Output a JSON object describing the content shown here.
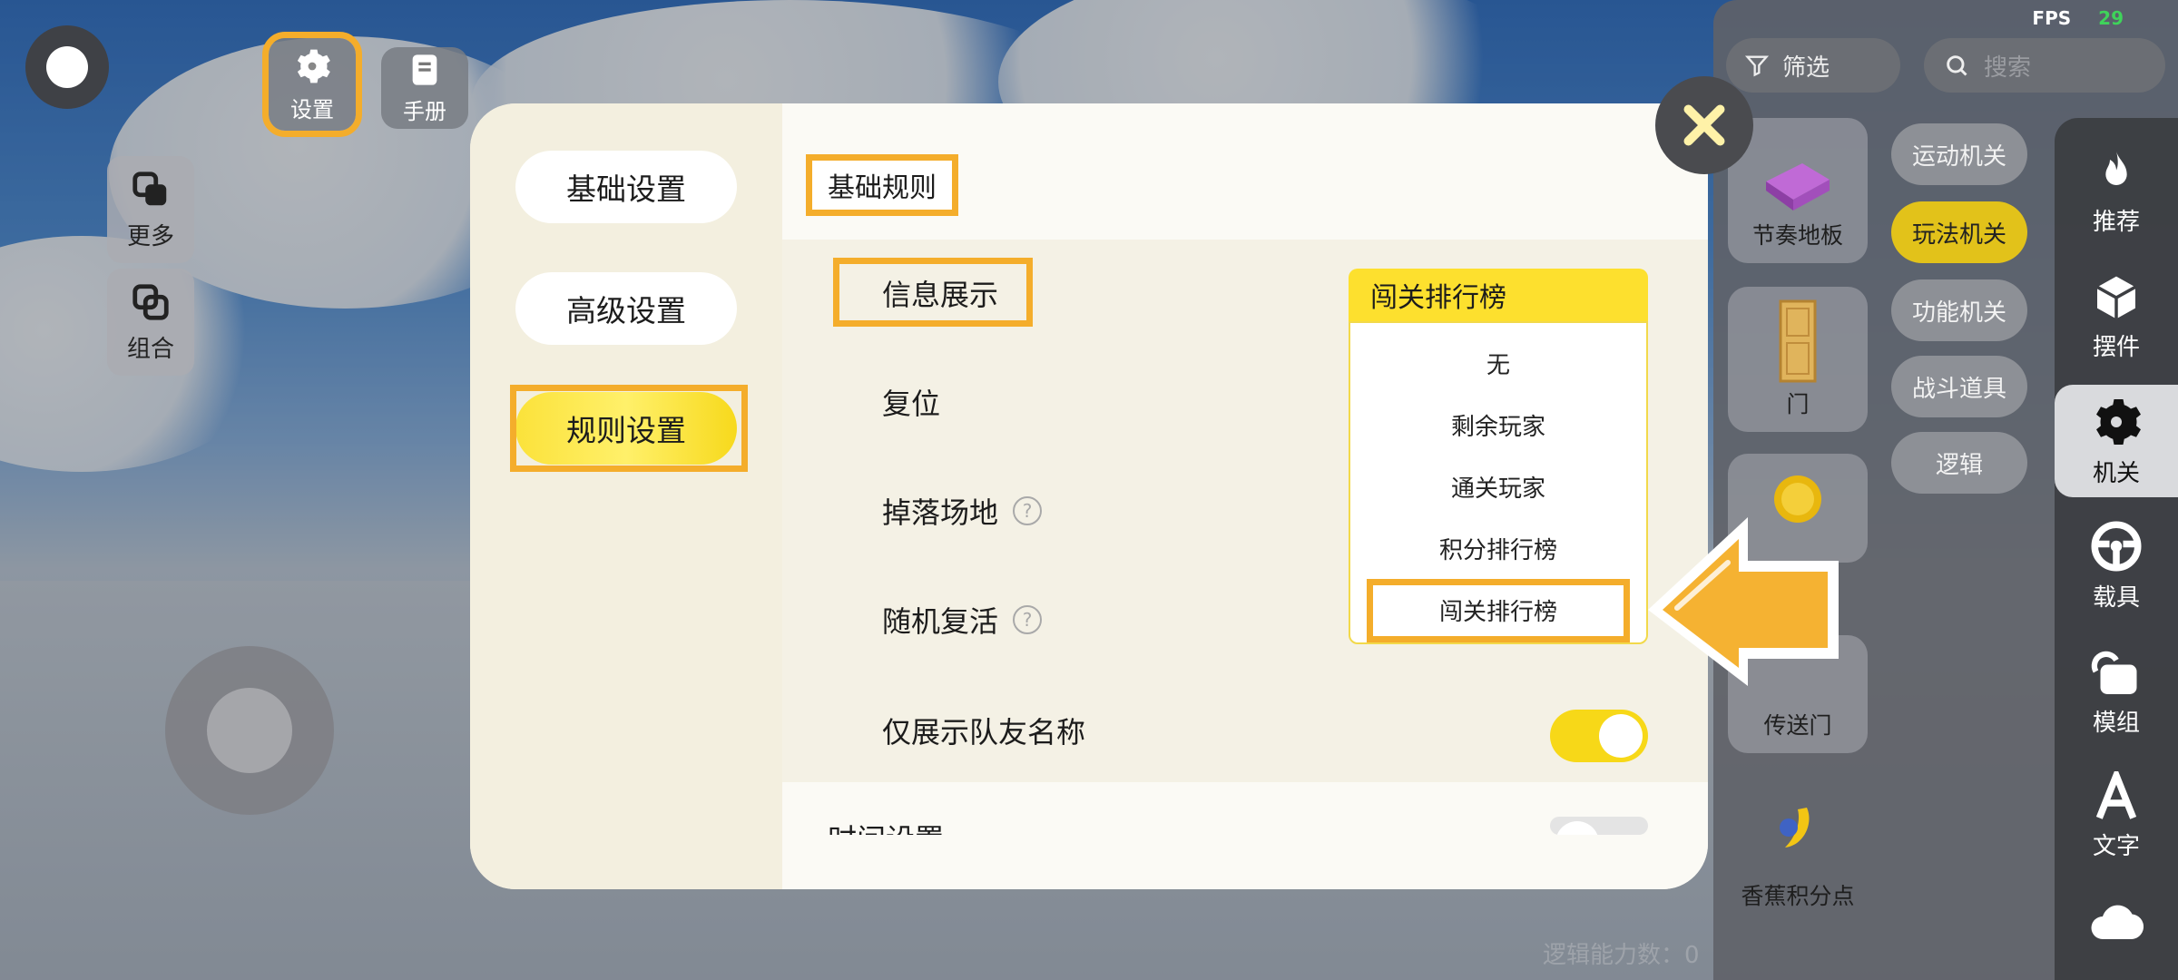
{
  "hud": {
    "fps_label": "FPS",
    "fps_value": "29",
    "settings_label": "设置",
    "manual_label": "手册",
    "more_label": "更多",
    "combine_label": "组合",
    "logic_count": "逻辑能力数：0"
  },
  "dialog": {
    "nav": [
      "基础设置",
      "高级设置",
      "规则设置"
    ],
    "section_title": "基础规则",
    "rows": {
      "info_display": "信息展示",
      "reset": "复位",
      "fall_area": "掉落场地",
      "random_respawn": "随机复活",
      "teammate_names_only": "仅展示队友名称",
      "time_settings": "时间设置"
    },
    "help_glyph": "?",
    "select_value": "闯关排行榜",
    "options": [
      "无",
      "剩余玩家",
      "通关玩家",
      "积分排行榜",
      "闯关排行榜"
    ]
  },
  "panel": {
    "filter_label": "筛选",
    "search_placeholder": "搜索",
    "categories": [
      "推荐",
      "摆件",
      "机关",
      "载具",
      "模组",
      "文字"
    ],
    "sub_tags": [
      "运动机关",
      "玩法机关",
      "功能机关",
      "战斗道具",
      "逻辑"
    ],
    "items": [
      "节奏地板",
      "门",
      "传送门",
      "香蕉积分点"
    ]
  },
  "colors": {
    "highlight": "#f4ad2b",
    "accent_yellow": "#fde02e",
    "fps_green": "#3fd35a"
  },
  "icons": [
    "settings-icon",
    "manual-icon",
    "more-icon",
    "combine-icon",
    "filter-icon",
    "search-icon",
    "close-icon",
    "flame-icon",
    "box-icon",
    "gear-icon",
    "steering-wheel-icon",
    "module-icon",
    "text-icon",
    "cloud-icon",
    "arrow-pointer-icon"
  ]
}
